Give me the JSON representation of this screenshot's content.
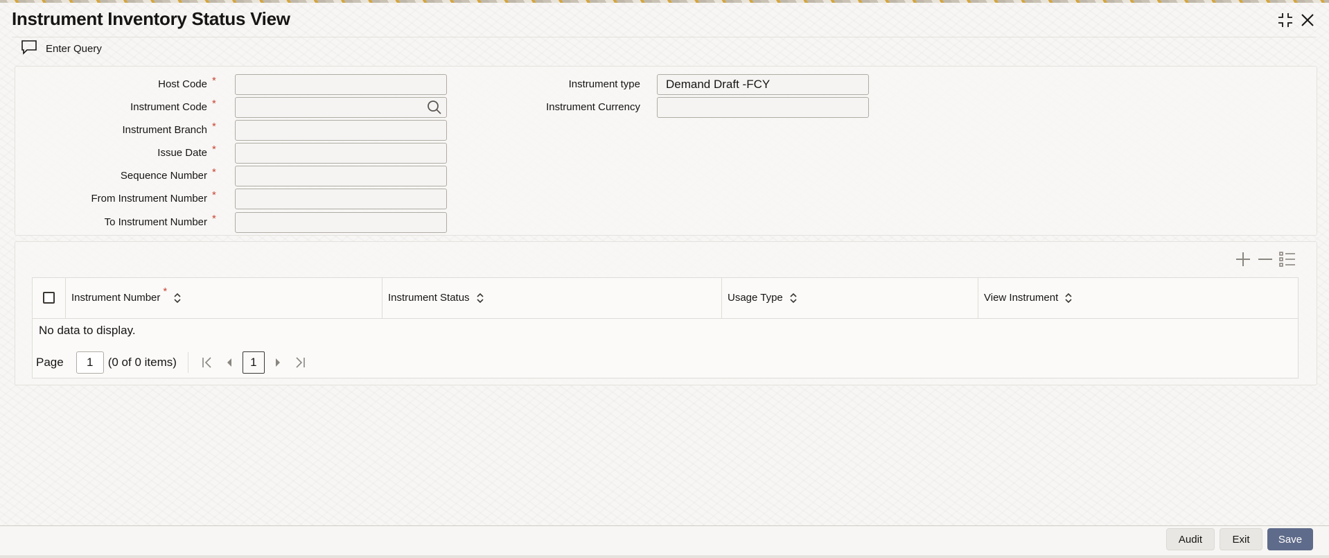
{
  "window": {
    "title": "Instrument Inventory Status View",
    "maximize_icon": "collapse-arrows-icon",
    "close_icon": "close-icon"
  },
  "toolbar": {
    "enter_query_label": "Enter Query",
    "enter_query_icon": "chat-bubble-icon"
  },
  "form": {
    "left_fields": [
      {
        "label": "Host Code",
        "required": true,
        "value": ""
      },
      {
        "label": "Instrument Code",
        "required": true,
        "value": "",
        "has_search": true
      },
      {
        "label": "Instrument Branch",
        "required": true,
        "value": ""
      },
      {
        "label": "Issue Date",
        "required": true,
        "value": ""
      },
      {
        "label": "Sequence Number",
        "required": true,
        "value": ""
      },
      {
        "label": "From Instrument Number",
        "required": true,
        "value": ""
      },
      {
        "label": "To Instrument Number",
        "required": true,
        "value": ""
      }
    ],
    "right_fields": [
      {
        "label": "Instrument type",
        "value": "Demand Draft -FCY"
      },
      {
        "label": "Instrument Currency",
        "value": ""
      }
    ],
    "required_marker": "*"
  },
  "grid": {
    "toolbar_icons": [
      "add-row-icon",
      "remove-row-icon",
      "column-list-icon"
    ],
    "columns": [
      {
        "label": "Instrument Number",
        "required": true
      },
      {
        "label": "Instrument Status",
        "required": false
      },
      {
        "label": "Usage Type",
        "required": false
      },
      {
        "label": "View Instrument",
        "required": false
      }
    ],
    "empty_message": "No data to display.",
    "pagination": {
      "page_label": "Page",
      "page_value": "1",
      "items_text": "(0 of 0 items)",
      "current_page": "1"
    }
  },
  "footer": {
    "audit_label": "Audit",
    "exit_label": "Exit",
    "save_label": "Save"
  },
  "colors": {
    "required": "#c74634",
    "primary_button": "#5f6b8a"
  }
}
